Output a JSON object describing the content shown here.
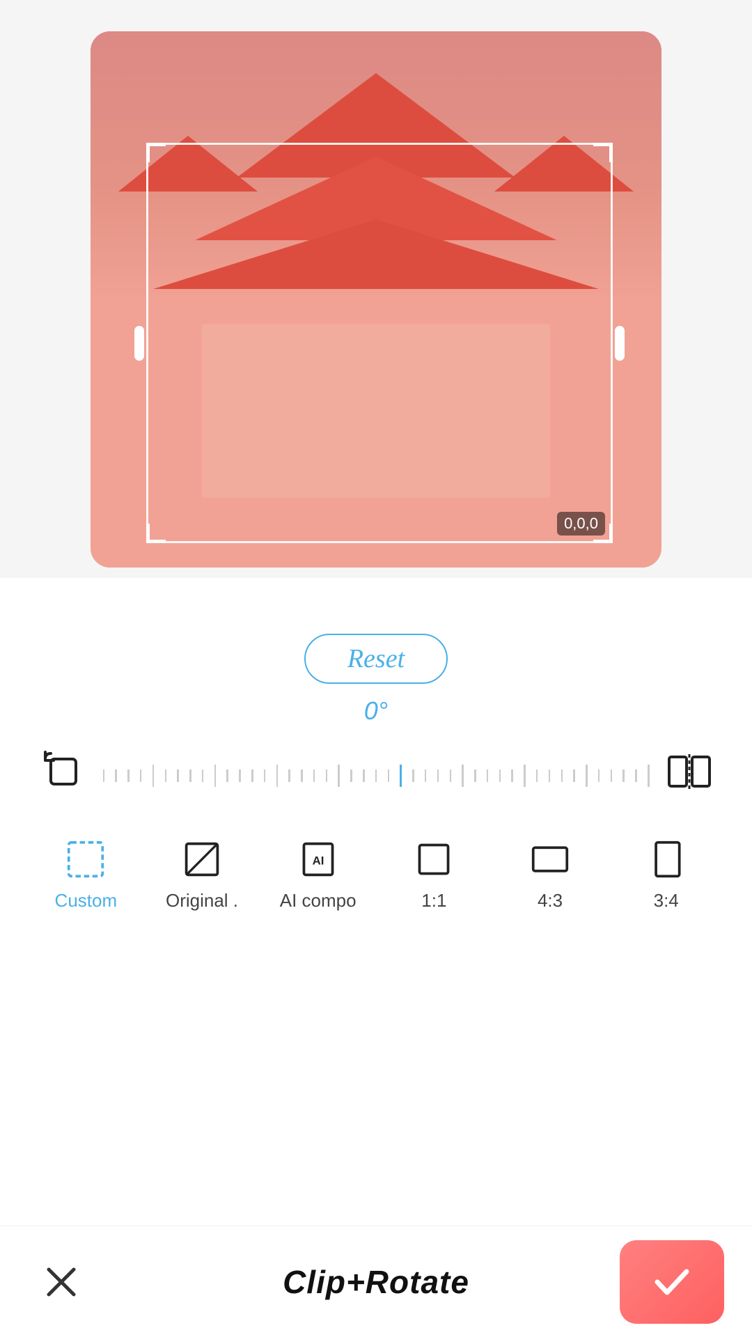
{
  "image": {
    "alt": "Thai temple aerial view"
  },
  "reset": {
    "button_label": "Reset",
    "angle": "0°"
  },
  "slider": {
    "rotate_icon": "rotate-counterclockwise",
    "flip_icon": "flip-horizontal"
  },
  "aspect_ratios": [
    {
      "id": "custom",
      "label": "Custom",
      "active": true
    },
    {
      "id": "original",
      "label": "Original .",
      "active": false
    },
    {
      "id": "ai_compose",
      "label": "AI compo",
      "active": false
    },
    {
      "id": "1_1",
      "label": "1:1",
      "active": false
    },
    {
      "id": "4_3",
      "label": "4:3",
      "active": false
    },
    {
      "id": "3_4",
      "label": "3:4",
      "active": false
    }
  ],
  "bottom_bar": {
    "cancel_label": "×",
    "title": "Clip+Rotate",
    "confirm_icon": "✓"
  },
  "colors": {
    "accent": "#4ab0e8",
    "confirm_bg": "#ff7070",
    "overlay": "rgba(255,100,90,0.38)"
  }
}
